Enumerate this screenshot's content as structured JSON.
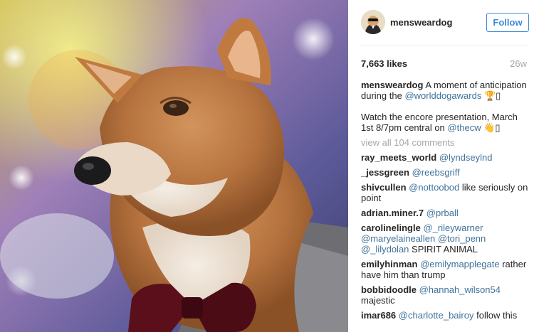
{
  "post": {
    "username": "mensweardog",
    "follow_label": "Follow",
    "likes": "7,663 likes",
    "time": "26w"
  },
  "caption": {
    "user": "mensweardog",
    "text1": "A moment of anticipation during the",
    "mention1": "@worlddogawards",
    "emoji1": "🏆▯",
    "text2": "Watch the encore presentation, March 1st 8/7pm central on",
    "mention2": "@thecw",
    "emoji2": "👋▯"
  },
  "view_all": "view all 104 comments",
  "comments": [
    {
      "user": "ray_meets_world",
      "mention": "@lyndseylnd",
      "text": ""
    },
    {
      "user": "_jessgreen",
      "mention": "@reebsgriff",
      "text": ""
    },
    {
      "user": "shivcullen",
      "mention": "@nottoobod",
      "text": "like seriously on point"
    },
    {
      "user": "adrian.miner.7",
      "mention": "@prball",
      "text": ""
    },
    {
      "user": "carolinelingle",
      "mention": "@_rileywarner @maryelaineallen @tori_penn @_lilydolan",
      "text": "SPIRIT ANIMAL"
    },
    {
      "user": "emilyhinman",
      "mention": "@emilymapplegate",
      "text": "rather have him than trump"
    },
    {
      "user": "bobbidoodle",
      "mention": "@hannah_wilson54",
      "text": "majestic"
    },
    {
      "user": "imar686",
      "mention": "@charlotte_bairoy",
      "text": "follow this"
    }
  ]
}
